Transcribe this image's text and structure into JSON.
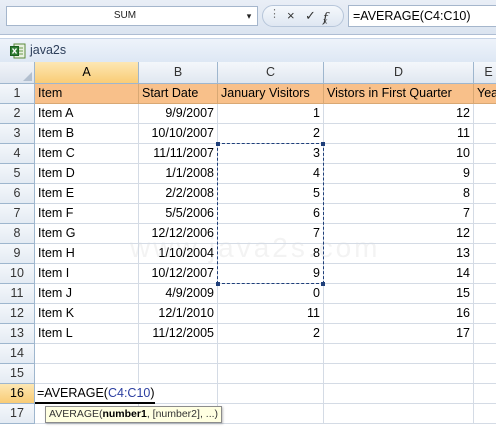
{
  "formula_bar": {
    "name_box": "SUM",
    "formula": "=AVERAGE(C4:C10)",
    "icons": {
      "cancel": "×",
      "enter": "✓",
      "fx": "f",
      "fx_sub": "x",
      "dropdown": "▾",
      "grip": "⋮"
    }
  },
  "window": {
    "title": "java2s"
  },
  "columns": [
    "A",
    "B",
    "C",
    "D",
    "E"
  ],
  "header_row": [
    "Item",
    "Start Date",
    "January Visitors",
    "Vistors in First Quarter",
    "Year"
  ],
  "rows": [
    {
      "n": "1"
    },
    {
      "n": "2",
      "cells": [
        "Item A",
        "9/9/2007",
        "1",
        "12"
      ]
    },
    {
      "n": "3",
      "cells": [
        "Item B",
        "10/10/2007",
        "2",
        "11"
      ]
    },
    {
      "n": "4",
      "cells": [
        "Item C",
        "11/11/2007",
        "3",
        "10"
      ]
    },
    {
      "n": "5",
      "cells": [
        "Item D",
        "1/1/2008",
        "4",
        "9"
      ]
    },
    {
      "n": "6",
      "cells": [
        "Item E",
        "2/2/2008",
        "5",
        "8"
      ]
    },
    {
      "n": "7",
      "cells": [
        "Item F",
        "5/5/2006",
        "6",
        "7"
      ]
    },
    {
      "n": "8",
      "cells": [
        "Item G",
        "12/12/2006",
        "7",
        "12"
      ]
    },
    {
      "n": "9",
      "cells": [
        "Item H",
        "1/10/2004",
        "8",
        "13"
      ]
    },
    {
      "n": "10",
      "cells": [
        "Item I",
        "10/12/2007",
        "9",
        "14"
      ]
    },
    {
      "n": "11",
      "cells": [
        "Item J",
        "4/9/2009",
        "0",
        "15"
      ]
    },
    {
      "n": "12",
      "cells": [
        "Item K",
        "12/1/2010",
        "11",
        "16"
      ]
    },
    {
      "n": "13",
      "cells": [
        "Item L",
        "11/12/2005",
        "2",
        "17"
      ]
    },
    {
      "n": "14"
    },
    {
      "n": "15"
    },
    {
      "n": "16"
    },
    {
      "n": "17"
    }
  ],
  "edit": {
    "prefix": "=AVERAGE(",
    "ref": "C4:C10",
    "suffix": ")"
  },
  "tooltip": {
    "fn": "AVERAGE(",
    "arg1": "number1",
    "rest": ", [number2], ...)"
  },
  "watermark": "www.java2s.com",
  "selected_column": "A",
  "selected_row": "16"
}
